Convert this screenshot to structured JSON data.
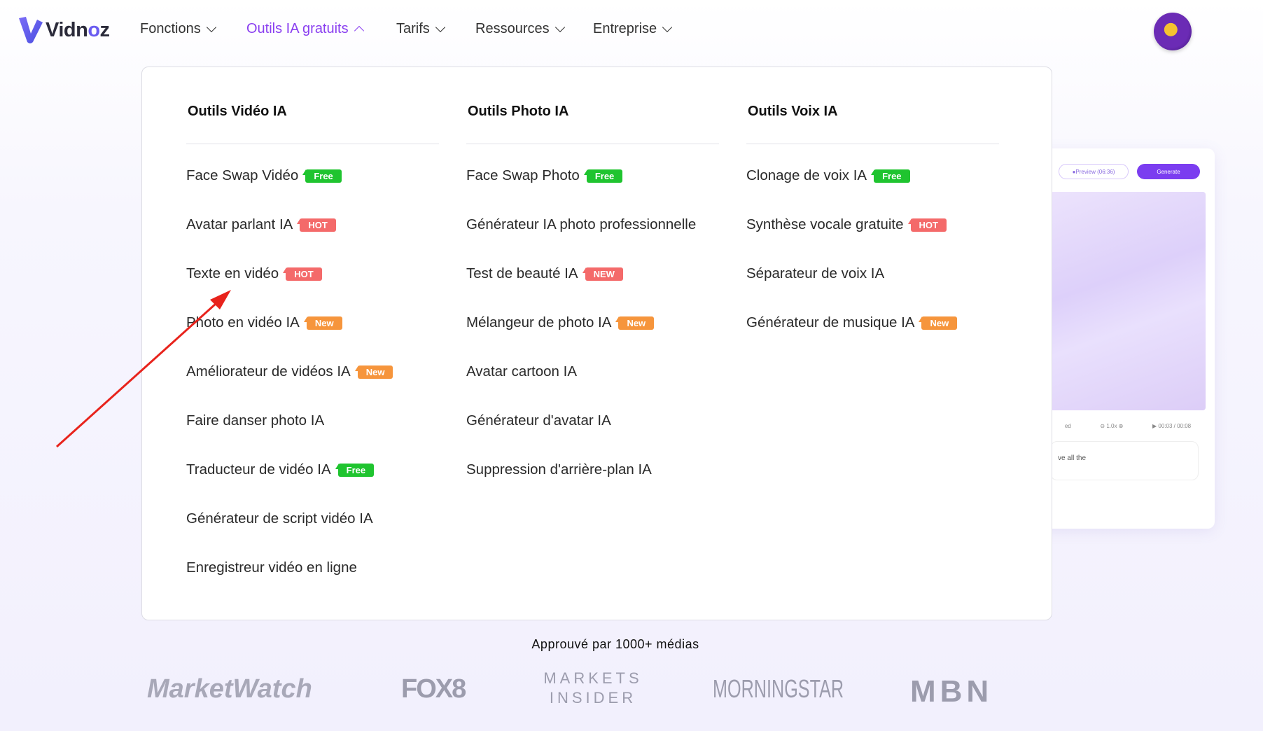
{
  "brand": {
    "name_a": "Vidn",
    "name_b": "o",
    "name_c": "z"
  },
  "nav": [
    {
      "label": "Fonctions",
      "state": "collapsed"
    },
    {
      "label": "Outils IA gratuits",
      "state": "expanded"
    },
    {
      "label": "Tarifs",
      "state": "collapsed"
    },
    {
      "label": "Ressources",
      "state": "collapsed"
    },
    {
      "label": "Entreprise",
      "state": "collapsed"
    }
  ],
  "colors": {
    "accent": "#8a3ff0",
    "free": "#1fc42f",
    "hot": "#f46a6a",
    "new": "#f6953c",
    "annotation_arrow": "#e8231c"
  },
  "menu": {
    "columns": [
      {
        "title": "Outils Vidéo IA",
        "items": [
          {
            "label": "Face Swap Vidéo",
            "badge": "Free",
            "type": "free"
          },
          {
            "label": "Avatar parlant IA",
            "badge": "HOT",
            "type": "hot"
          },
          {
            "label": "Texte en vidéo",
            "badge": "HOT",
            "type": "hot"
          },
          {
            "label": "Photo en vidéo IA",
            "badge": "New",
            "type": "new"
          },
          {
            "label": "Améliorateur de vidéos IA",
            "badge": "New",
            "type": "new"
          },
          {
            "label": "Faire danser photo IA"
          },
          {
            "label": "Traducteur de vidéo IA",
            "badge": "Free",
            "type": "free"
          },
          {
            "label": "Générateur de script vidéo IA"
          },
          {
            "label": "Enregistreur vidéo en ligne"
          }
        ]
      },
      {
        "title": "Outils Photo IA",
        "items": [
          {
            "label": "Face Swap Photo",
            "badge": "Free",
            "type": "free"
          },
          {
            "label": "Générateur IA photo professionnelle"
          },
          {
            "label": "Test de beauté IA",
            "badge": "NEW",
            "type": "hot"
          },
          {
            "label": "Mélangeur de photo IA",
            "badge": "New",
            "type": "new"
          },
          {
            "label": "Avatar cartoon IA"
          },
          {
            "label": "Générateur d'avatar IA"
          },
          {
            "label": "Suppression d'arrière-plan IA"
          }
        ]
      },
      {
        "title": "Outils Voix IA",
        "items": [
          {
            "label": "Clonage de voix IA",
            "badge": "Free",
            "type": "free"
          },
          {
            "label": "Synthèse vocale gratuite",
            "badge": "HOT",
            "type": "hot"
          },
          {
            "label": "Séparateur de voix IA"
          },
          {
            "label": "Générateur de musique IA",
            "badge": "New",
            "type": "new"
          }
        ]
      }
    ]
  },
  "preview": {
    "preview_btn": "Preview (06:36)",
    "generate_btn": "Generate",
    "speed_label": "ed",
    "speed": "1.0x",
    "time": "00:03 / 00:08",
    "text": "ve all the"
  },
  "media": {
    "title": "Approuvé par 1000+ médias",
    "logos": [
      "MarketWatch",
      "FOX8",
      "MARKETS INSIDER",
      "MORNINGSTAR",
      "MBN"
    ]
  }
}
